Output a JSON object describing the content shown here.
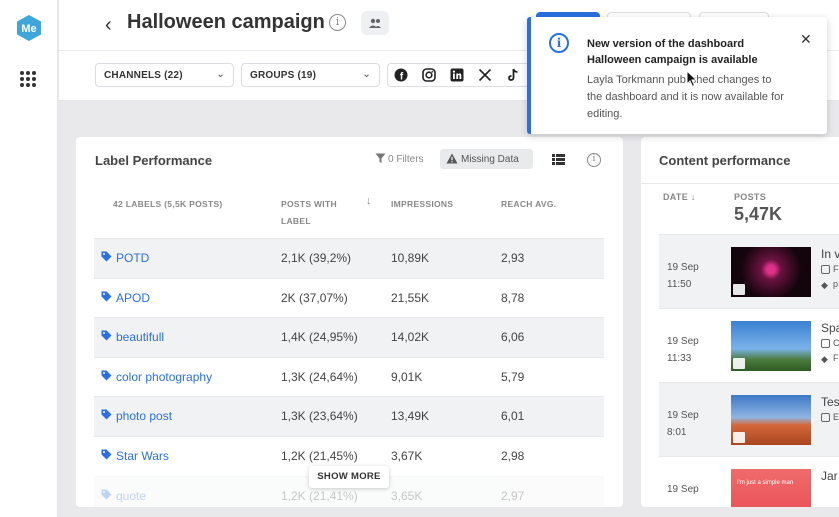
{
  "header": {
    "title": "Halloween campaign",
    "back_icon": "chevron-left-icon",
    "info_icon": "info-icon",
    "share_icon": "people-icon"
  },
  "brand": {
    "logo_text": "Me",
    "logo_color": "#3ea7d8",
    "accent": "#2b6fe0"
  },
  "filters": {
    "channels_label": "CHANNELS (22)",
    "groups_label": "GROUPS (19)",
    "networks": [
      "facebook",
      "instagram",
      "linkedin",
      "x",
      "tiktok"
    ]
  },
  "toast": {
    "title": "New version of the dashboard Halloween campaign is available",
    "body": "Layla Torkmann published changes to the dashboard and it is now available for editing.",
    "close": "✕"
  },
  "label_performance": {
    "title": "Label Performance",
    "filters_label": "0 Filters",
    "missing_data_label": "Missing Data",
    "columns": {
      "label": "42 LABELS (5,5K POSTS)",
      "posts_line1": "POSTS WITH",
      "posts_line2": "LABEL",
      "impressions": "IMPRESSIONS",
      "reach": "REACH AVG."
    },
    "rows": [
      {
        "label": "POTD",
        "posts": "2,1K (39,2%)",
        "impressions": "10,89K",
        "reach": "2,93"
      },
      {
        "label": "APOD",
        "posts": "2K (37,07%)",
        "impressions": "21,55K",
        "reach": "8,78"
      },
      {
        "label": "beautifull",
        "posts": "1,4K (24,95%)",
        "impressions": "14,02K",
        "reach": "6,06"
      },
      {
        "label": "color photography",
        "posts": "1,3K (24,64%)",
        "impressions": "9,01K",
        "reach": "5,79"
      },
      {
        "label": "photo post",
        "posts": "1,3K (23,64%)",
        "impressions": "13,49K",
        "reach": "6,01"
      },
      {
        "label": "Star Wars",
        "posts": "1,2K (21,45%)",
        "impressions": "3,67K",
        "reach": "2,98"
      },
      {
        "label": "quote",
        "posts": "1,2K (21,41%)",
        "impressions": "3,65K",
        "reach": "2,97"
      }
    ],
    "show_more": "SHOW MORE"
  },
  "content_performance": {
    "title": "Content performance",
    "date_header": "DATE",
    "posts_header": "POSTS",
    "posts_total": "5,47K",
    "rows": [
      {
        "date": "19 Sep",
        "time": "11:50",
        "title": "In v",
        "m1": "F",
        "m2": "p"
      },
      {
        "date": "19 Sep",
        "time": "11:33",
        "title": "Spa",
        "m1": "C",
        "m2": "F"
      },
      {
        "date": "19 Sep",
        "time": "8:01",
        "title": "Tes",
        "m1": "E",
        "m2": ""
      },
      {
        "date": "19 Sep",
        "time": "",
        "title": "Jar",
        "m1": "",
        "m2": "",
        "thumb_text": "I'm just a simple man"
      }
    ]
  }
}
